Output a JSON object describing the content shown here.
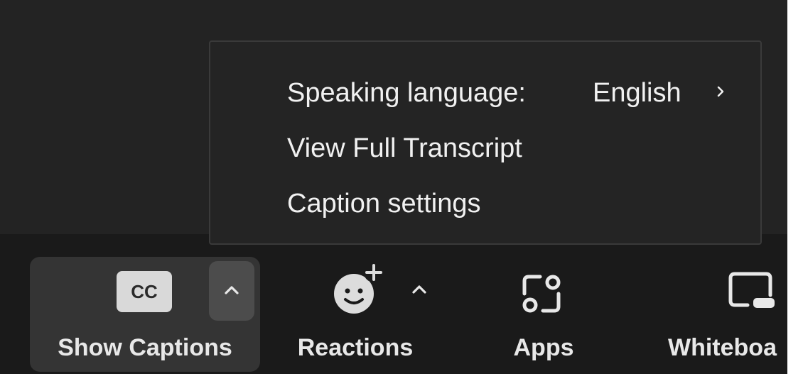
{
  "menu": {
    "items": [
      {
        "label": "Speaking language:",
        "value": "English"
      },
      {
        "label": "View Full Transcript"
      },
      {
        "label": "Caption settings"
      }
    ]
  },
  "toolbar": {
    "captions": {
      "label": "Show Captions",
      "icon_text": "CC",
      "icon": "cc-icon"
    },
    "reactions": {
      "label": "Reactions",
      "icon": "smiley-plus-icon"
    },
    "apps": {
      "label": "Apps",
      "icon": "apps-icon"
    },
    "whiteboard": {
      "label": "Whiteboa",
      "icon": "whiteboard-icon"
    }
  },
  "colors": {
    "meeting_bg": "#232323",
    "toolbar_bg": "#1a1a1a",
    "menu_bg": "#242424",
    "menu_border": "#3a3a3a",
    "active_button_bg": "#343434",
    "text": "#f1f1f1"
  }
}
